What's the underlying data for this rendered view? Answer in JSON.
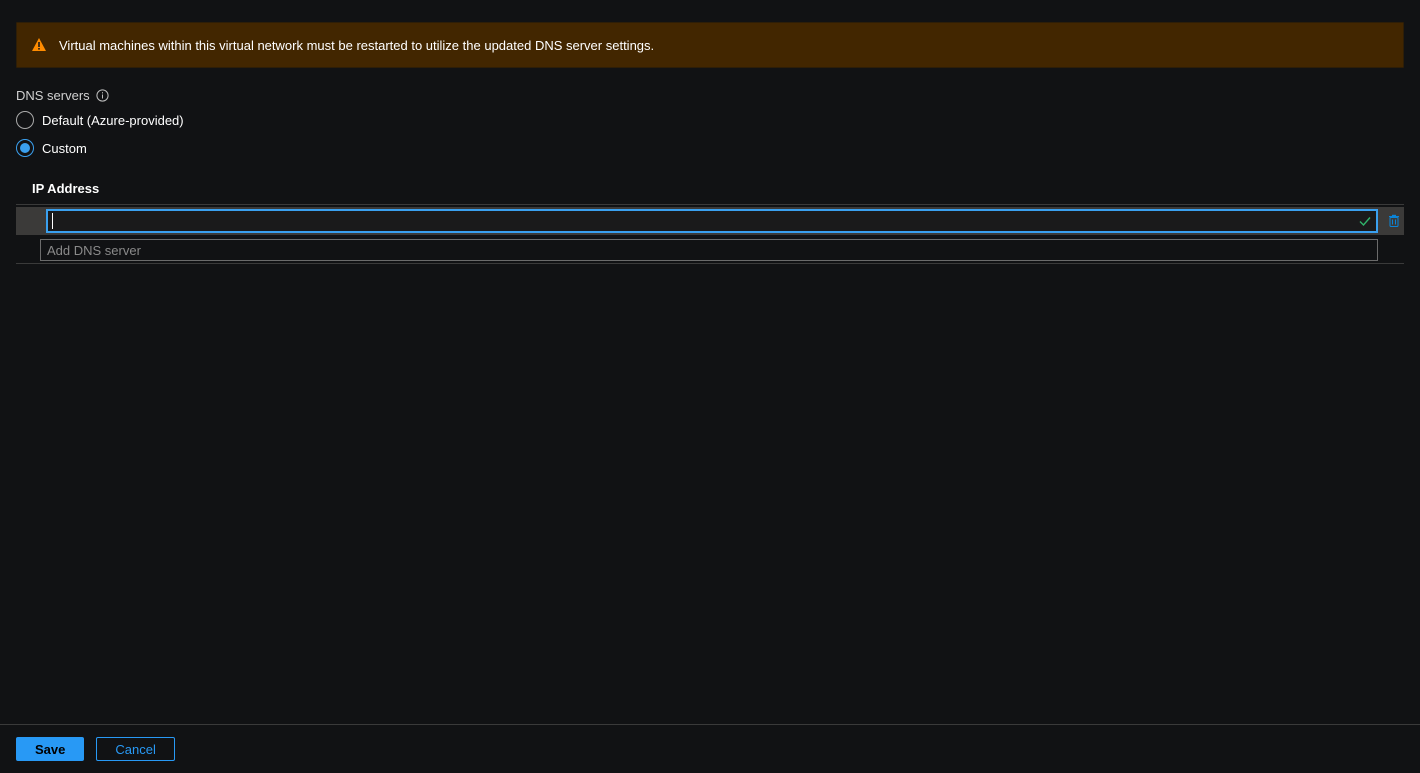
{
  "banner": {
    "message": "Virtual machines within this virtual network must be restarted to utilize the updated DNS server settings."
  },
  "dns": {
    "section_label": "DNS servers",
    "options": {
      "default": "Default (Azure-provided)",
      "custom": "Custom"
    },
    "selected": "custom"
  },
  "ip": {
    "header": "IP Address",
    "current_value": "",
    "add_placeholder": "Add DNS server"
  },
  "footer": {
    "save": "Save",
    "cancel": "Cancel"
  },
  "colors": {
    "accent": "#2899f5",
    "banner_bg": "#422600",
    "bg": "#111214"
  }
}
